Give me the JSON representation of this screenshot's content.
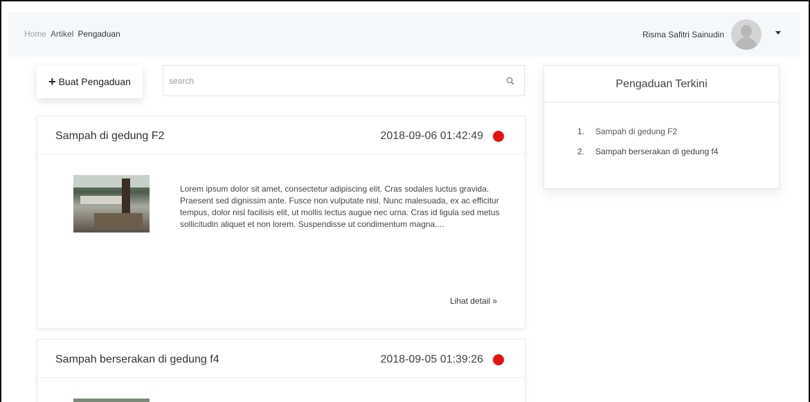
{
  "nav": {
    "links": [
      "Home",
      "Artikel",
      "Pengaduan"
    ],
    "user_name": "Risma Safitri Sainudin"
  },
  "toolbar": {
    "create_label": "Buat Pengaduan",
    "search_placeholder": "search"
  },
  "complaints": [
    {
      "title": "Sampah di gedung F2",
      "date": "2018-09-06 01:42:49",
      "status_color": "#e8120d",
      "text": "Lorem ipsum dolor sit amet, consectetur adipiscing elit. Cras sodales luctus gravida. Praesent sed dignissim ante. Fusce non vulputate nisl. Nunc malesuada, ex ac efficitur tempus, dolor nisl facilisis elit, ut mollis lectus augue nec urna. Cras id ligula sed metus sollicitudin aliquet et non lorem. Suspendisse ut condimentum magna....",
      "detail_label": "Lihat detail »"
    },
    {
      "title": "Sampah berserakan di gedung f4",
      "date": "2018-09-05 01:39:26",
      "status_color": "#e8120d"
    }
  ],
  "sidebar": {
    "title": "Pengaduan Terkini",
    "items": [
      {
        "num": "1.",
        "label": "Sampah di gedung F2"
      },
      {
        "num": "2.",
        "label": "Sampah berserakan di gedung f4"
      }
    ]
  }
}
